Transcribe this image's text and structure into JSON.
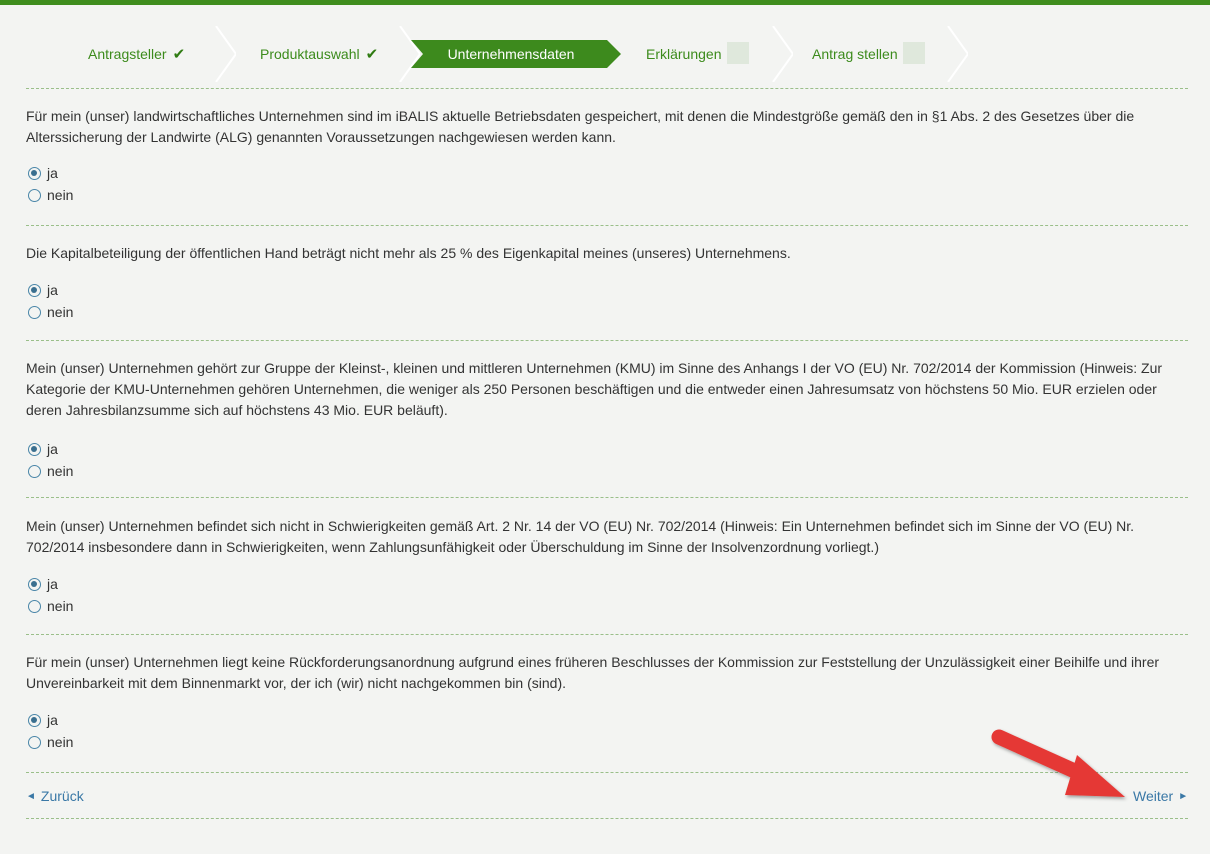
{
  "wizard": {
    "steps": [
      {
        "label": "Antragsteller",
        "mark": "✔"
      },
      {
        "label": "Produktauswahl",
        "mark": "✔"
      },
      {
        "label": "Unternehmensdaten",
        "mark": ""
      },
      {
        "label": "Erklärungen",
        "mark": ""
      },
      {
        "label": "Antrag stellen",
        "mark": ""
      }
    ]
  },
  "questions": [
    {
      "text": "Für mein (unser) landwirtschaftliches Unternehmen sind im iBALIS aktuelle Betriebsdaten gespeichert, mit denen die Mindestgröße gemäß den in §1 Abs. 2 des Gesetzes über die Alterssicherung der Landwirte (ALG) genannten Voraussetzungen nachgewiesen werden kann.",
      "yes": "ja",
      "no": "nein",
      "selected": "ja"
    },
    {
      "text": "Die Kapitalbeteiligung der öffentlichen Hand beträgt nicht mehr als 25 % des Eigenkapital meines (unseres) Unternehmens.",
      "yes": "ja",
      "no": "nein",
      "selected": "ja"
    },
    {
      "text": "Mein (unser) Unternehmen gehört zur Gruppe der Kleinst-, kleinen und mittleren Unternehmen (KMU) im Sinne des Anhangs I der VO (EU) Nr. 702/2014 der Kommission (Hinweis: Zur Kategorie der KMU-Unternehmen gehören Unternehmen, die weniger als 250 Personen beschäftigen und die entweder einen Jahresumsatz von höchstens 50 Mio. EUR erzielen oder deren Jahresbilanzsumme sich auf höchstens 43 Mio. EUR beläuft).",
      "yes": "ja",
      "no": "nein",
      "selected": "ja"
    },
    {
      "text": "Mein (unser) Unternehmen befindet sich nicht in Schwierigkeiten gemäß Art. 2 Nr. 14 der VO (EU) Nr. 702/2014 (Hinweis: Ein Unternehmen befindet sich im Sinne der VO (EU) Nr. 702/2014 insbesondere dann in Schwierigkeiten, wenn Zahlungsunfähigkeit oder Überschuldung im Sinne der Insolvenzordnung vorliegt.)",
      "yes": "ja",
      "no": "nein",
      "selected": "ja"
    },
    {
      "text": "Für mein (unser) Unternehmen liegt keine Rückforderungsanordnung aufgrund eines früheren Beschlusses der Kommission zur Feststellung der Unzulässigkeit einer Beihilfe und ihrer Unvereinbarkeit mit dem Binnenmarkt vor, der ich (wir) nicht nachgekommen bin (sind).",
      "yes": "ja",
      "no": "nein",
      "selected": "ja"
    }
  ],
  "nav": {
    "back_label": "Zurück",
    "back_icon": "◄",
    "next_label": "Weiter",
    "next_icon": "►"
  },
  "colors": {
    "brand_green": "#3f8d1e",
    "active_step_bg": "#3d8a1d",
    "link_blue": "#3a78a6",
    "annotation_red": "#e53935"
  }
}
